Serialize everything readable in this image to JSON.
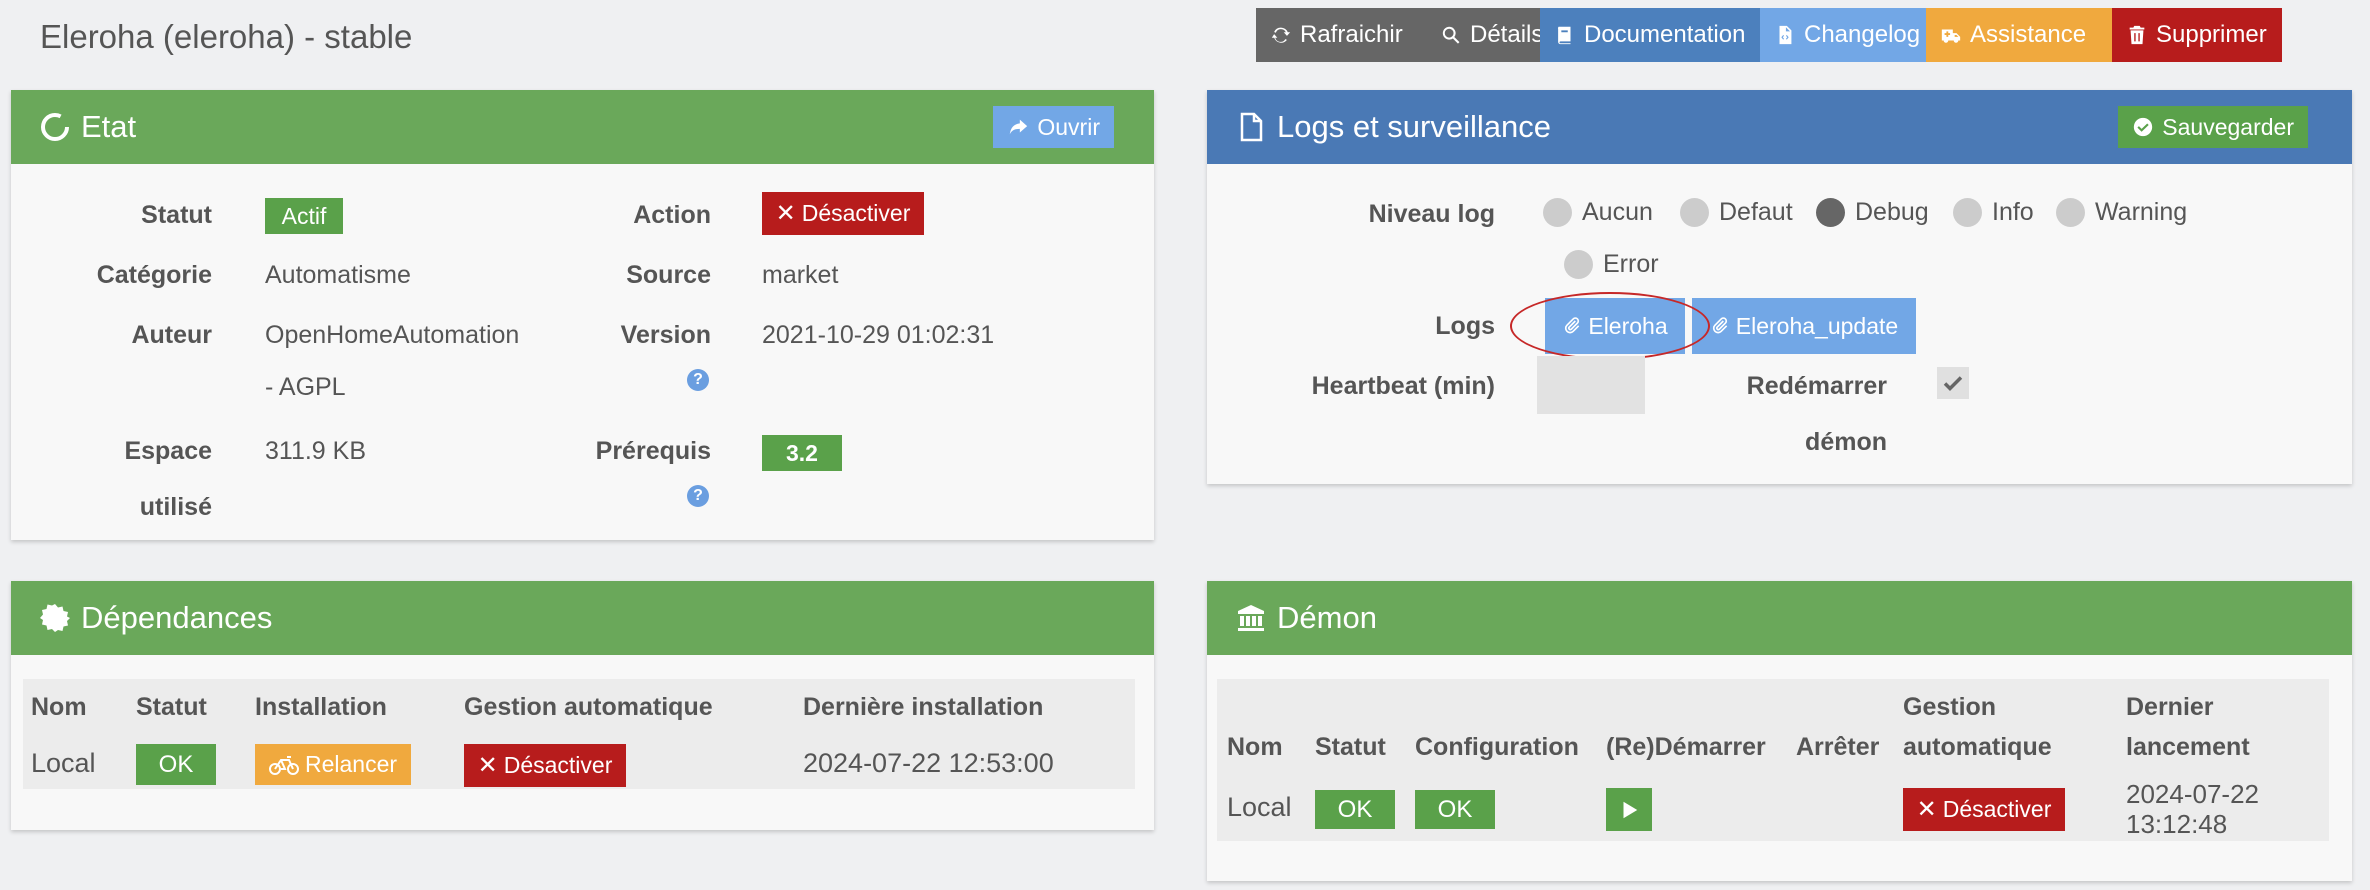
{
  "page_title": "Eleroha (eleroha) - stable",
  "toolbar": {
    "refresh": "Rafraichir",
    "details": "Détails",
    "documentation": "Documentation",
    "changelog": "Changelog",
    "assistance": "Assistance",
    "delete": "Supprimer"
  },
  "colors": {
    "green": "#6aa85a",
    "blue": "#4a79b5",
    "red": "#b71c1c",
    "orange": "#f0a93e",
    "light_blue": "#72a7e6"
  },
  "etat": {
    "title": "Etat",
    "open_button": "Ouvrir",
    "statut_label": "Statut",
    "statut_value": "Actif",
    "action_label": "Action",
    "action_button": "Désactiver",
    "categorie_label": "Catégorie",
    "categorie_value": "Automatisme",
    "source_label": "Source",
    "source_value": "market",
    "auteur_label": "Auteur",
    "auteur_value_1": "OpenHomeAutomation",
    "auteur_value_2": "- AGPL",
    "version_label": "Version",
    "version_value": "2021-10-29 01:02:31",
    "espace_label_1": "Espace",
    "espace_label_2": "utilisé",
    "espace_value": "311.9 KB",
    "prerequis_label": "Prérequis",
    "prerequis_value": "3.2",
    "help_glyph": "?"
  },
  "logs": {
    "title": "Logs et surveillance",
    "save_button": "Sauvegarder",
    "niveau_label": "Niveau log",
    "levels": [
      "Aucun",
      "Defaut",
      "Debug",
      "Info",
      "Warning",
      "Error"
    ],
    "selected_level": "Debug",
    "logs_label": "Logs",
    "log_buttons": [
      "Eleroha",
      "Eleroha_update"
    ],
    "heartbeat_label": "Heartbeat (min)",
    "heartbeat_value": "",
    "restart_label_1": "Redémarrer",
    "restart_label_2": "démon",
    "restart_checked": true
  },
  "dependances": {
    "title": "Dépendances",
    "headers": [
      "Nom",
      "Statut",
      "Installation",
      "Gestion automatique",
      "Dernière installation"
    ],
    "row": {
      "nom": "Local",
      "statut": "OK",
      "installation": "Relancer",
      "gestion": "Désactiver",
      "derniere": "2024-07-22 12:53:00"
    }
  },
  "demon": {
    "title": "Démon",
    "headers": [
      "Nom",
      "Statut",
      "Configuration",
      "(Re)Démarrer",
      "Arrêter",
      "Gestion",
      "automatique",
      "Dernier",
      "lancement"
    ],
    "row": {
      "nom": "Local",
      "statut": "OK",
      "configuration": "OK",
      "gestion": "Désactiver",
      "dernier_1": "2024-07-22",
      "dernier_2": "13:12:48"
    }
  }
}
